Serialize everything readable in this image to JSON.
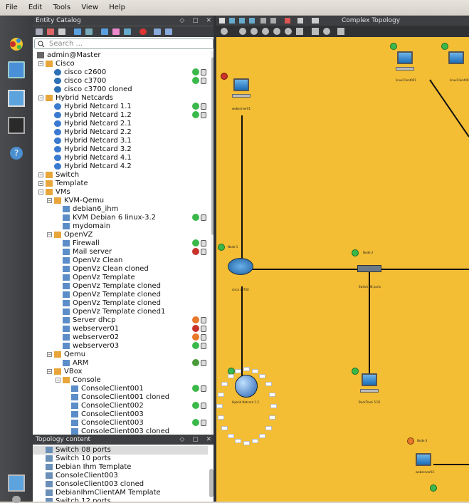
{
  "menu": [
    "File",
    "Edit",
    "Tools",
    "View",
    "Help"
  ],
  "entity_catalog": {
    "title": "Entity Catalog",
    "search_placeholder": "Search ...",
    "tree": [
      {
        "label": "admin@Master",
        "level": 0,
        "icon": "user-icon"
      },
      {
        "label": "Cisco",
        "level": 1,
        "icon": "folder-icon"
      },
      {
        "label": "cisco c2600",
        "level": 2,
        "icon": "router-icon",
        "status": "green"
      },
      {
        "label": "cisco c3700",
        "level": 2,
        "icon": "router-icon",
        "status": "green"
      },
      {
        "label": "cisco c3700 cloned",
        "level": 2,
        "icon": "router-icon"
      },
      {
        "label": "Hybrid Netcards",
        "level": 1,
        "icon": "folder-icon"
      },
      {
        "label": "Hybrid Netcard 1.1",
        "level": 2,
        "icon": "globe-icon",
        "status": "green"
      },
      {
        "label": "Hybrid Netcard 1.2",
        "level": 2,
        "icon": "globe-icon",
        "status": "green"
      },
      {
        "label": "Hybrid Netcard 2.1",
        "level": 2,
        "icon": "globe-icon"
      },
      {
        "label": "Hybrid Netcard 2.2",
        "level": 2,
        "icon": "globe-icon"
      },
      {
        "label": "Hybrid Netcard 3.1",
        "level": 2,
        "icon": "globe-icon"
      },
      {
        "label": "Hybrid Netcard 3.2",
        "level": 2,
        "icon": "globe-icon"
      },
      {
        "label": "Hybrid Netcard 4.1",
        "level": 2,
        "icon": "globe-icon"
      },
      {
        "label": "Hybrid Netcard 4.2",
        "level": 2,
        "icon": "globe-icon"
      },
      {
        "label": "Switch",
        "level": 1,
        "icon": "folder-icon"
      },
      {
        "label": "Template",
        "level": 1,
        "icon": "folder-icon"
      },
      {
        "label": "VMs",
        "level": 1,
        "icon": "folder-icon"
      },
      {
        "label": "KVM-Qemu",
        "level": 2,
        "icon": "folder-icon"
      },
      {
        "label": "debian6_ihm",
        "level": 3,
        "icon": "pc-icon"
      },
      {
        "label": "KVM Debian 6 linux-3.2",
        "level": 3,
        "icon": "pc-icon",
        "status": "green"
      },
      {
        "label": "mydomain",
        "level": 3,
        "icon": "pc-icon"
      },
      {
        "label": "OpenVZ",
        "level": 2,
        "icon": "folder-icon"
      },
      {
        "label": "Firewall",
        "level": 3,
        "icon": "pc-icon",
        "status": "green"
      },
      {
        "label": "Mail server",
        "level": 3,
        "icon": "pc-icon",
        "status": "red"
      },
      {
        "label": "OpenVz Clean",
        "level": 3,
        "icon": "pc-icon"
      },
      {
        "label": "OpenVz Clean cloned",
        "level": 3,
        "icon": "pc-icon"
      },
      {
        "label": "OpenVz Template",
        "level": 3,
        "icon": "pc-icon"
      },
      {
        "label": "OpenVz Template cloned",
        "level": 3,
        "icon": "pc-icon"
      },
      {
        "label": "OpenVz Template cloned",
        "level": 3,
        "icon": "pc-icon"
      },
      {
        "label": "OpenVz Template cloned",
        "level": 3,
        "icon": "pc-icon"
      },
      {
        "label": "OpenVz Template cloned1",
        "level": 3,
        "icon": "pc-icon"
      },
      {
        "label": "Server dhcp",
        "level": 3,
        "icon": "pc-icon",
        "status": "orange"
      },
      {
        "label": "webserver01",
        "level": 3,
        "icon": "pc-icon",
        "status": "red"
      },
      {
        "label": "webserver02",
        "level": 3,
        "icon": "pc-icon",
        "status": "orange"
      },
      {
        "label": "webserver03",
        "level": 3,
        "icon": "pc-icon",
        "status": "green"
      },
      {
        "label": "Qemu",
        "level": 2,
        "icon": "folder-icon"
      },
      {
        "label": "ARM",
        "level": 3,
        "icon": "pc-icon",
        "status": "pause"
      },
      {
        "label": "VBox",
        "level": 2,
        "icon": "folder-icon"
      },
      {
        "label": "Console",
        "level": 3,
        "icon": "folder-icon"
      },
      {
        "label": "ConsoleClient001",
        "level": 4,
        "icon": "pc-icon",
        "status": "green"
      },
      {
        "label": "ConsoleClient001 cloned",
        "level": 4,
        "icon": "pc-icon"
      },
      {
        "label": "ConsoleClient002",
        "level": 4,
        "icon": "pc-icon",
        "status": "green"
      },
      {
        "label": "ConsoleClient003",
        "level": 4,
        "icon": "pc-icon"
      },
      {
        "label": "ConsoleClient003",
        "level": 4,
        "icon": "pc-icon",
        "status": "green"
      },
      {
        "label": "ConsoleClient003 cloned",
        "level": 4,
        "icon": "pc-icon"
      }
    ]
  },
  "topology_content": {
    "title": "Topology content",
    "items": [
      "Switch 08 ports",
      "Switch 10 ports",
      "Debian Ihm Template",
      "ConsoleClient003",
      "ConsoleClient003 cloned",
      "DebianIhmClientAM Template",
      "Switch 12 ports"
    ]
  },
  "canvas": {
    "tab_label": "Complex Topology",
    "nodes": {
      "webserver": "webserver01",
      "cisco": "cisco c3700",
      "switch": "Switch 08 ports",
      "hybrid": "Hybrid Netcard 1.2",
      "backtrack": "BackTrack 5 R1",
      "webserver2": "webserver02",
      "client1": "linuxClient001",
      "client2": "linuxClient002",
      "node1": "Node 1",
      "node2": "Node 2",
      "node3": "Node 3"
    }
  },
  "colors": {
    "canvas": "#f3bd34",
    "green": "#3bb84a",
    "red": "#c8322a",
    "orange": "#e8782a"
  }
}
